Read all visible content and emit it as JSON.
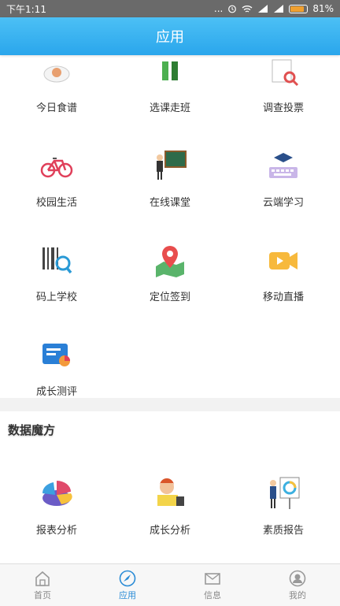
{
  "status": {
    "time": "下午1:11",
    "signal_text": "...",
    "battery_pct": "81%",
    "battery_level": 0.81
  },
  "header": {
    "title": "应用"
  },
  "apps": [
    {
      "label": "今日食谱",
      "icon": "recipe-icon"
    },
    {
      "label": "选课走班",
      "icon": "class-select-icon"
    },
    {
      "label": "调查投票",
      "icon": "survey-icon"
    },
    {
      "label": "校园生活",
      "icon": "bicycle-icon"
    },
    {
      "label": "在线课堂",
      "icon": "teacher-board-icon"
    },
    {
      "label": "云端学习",
      "icon": "keyboard-graduation-icon"
    },
    {
      "label": "码上学校",
      "icon": "barcode-search-icon"
    },
    {
      "label": "定位签到",
      "icon": "map-pin-icon"
    },
    {
      "label": "移动直播",
      "icon": "video-camera-icon"
    },
    {
      "label": "成长测评",
      "icon": "assessment-chart-icon"
    }
  ],
  "data_section": {
    "title": "数据魔方",
    "items": [
      {
        "label": "报表分析",
        "icon": "pie-chart-icon"
      },
      {
        "label": "成长分析",
        "icon": "child-reading-icon"
      },
      {
        "label": "素质报告",
        "icon": "presenter-board-icon"
      }
    ]
  },
  "tabs": [
    {
      "label": "首页",
      "icon": "home-icon",
      "active": false
    },
    {
      "label": "应用",
      "icon": "compass-icon",
      "active": true
    },
    {
      "label": "信息",
      "icon": "mail-icon",
      "active": false
    },
    {
      "label": "我的",
      "icon": "user-icon",
      "active": false
    }
  ],
  "colors": {
    "header_top": "#4cc0f5",
    "header_bottom": "#2aa6ec",
    "tab_active": "#2a8bd6"
  }
}
